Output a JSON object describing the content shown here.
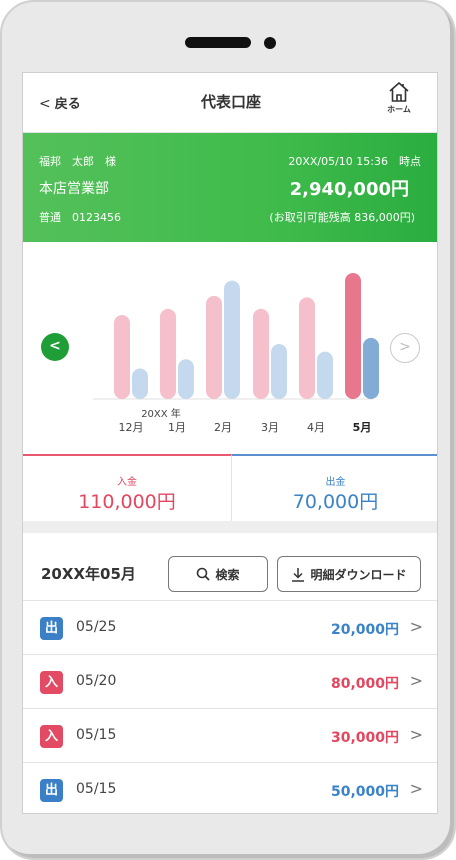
{
  "header": {
    "back_label": "戻る",
    "back_chevron": "<",
    "title": "代表口座",
    "home_label": "ホーム",
    "home_icon": "home-icon"
  },
  "account": {
    "owner": "福邦　太郎　様",
    "timestamp": "20XX/05/10 15:36　時点",
    "branch": "本店営業部",
    "balance": "2,940,000円",
    "account_type_number": "普通　0123456",
    "available": "(お取引可能残高 836,000円)"
  },
  "chart_data": {
    "type": "bar",
    "year_label": "20XX 年",
    "categories": [
      "12月",
      "1月",
      "2月",
      "3月",
      "4月",
      "5月"
    ],
    "selected_index": 5,
    "series": [
      {
        "name": "入金",
        "values": [
          110,
          118,
          135,
          118,
          133,
          165
        ],
        "color": "#f5c0cc",
        "selected_color": "#e8768c"
      },
      {
        "name": "出金",
        "values": [
          40,
          52,
          155,
          72,
          62,
          80
        ],
        "color": "#c5d9ee",
        "selected_color": "#82acd6"
      }
    ],
    "colors": {
      "deposit": "#f5c0cc",
      "withdrawal": "#c5d9ee"
    }
  },
  "summary": {
    "deposit_label": "入金",
    "deposit_value": "110,000円",
    "withdrawal_label": "出金",
    "withdrawal_value": "70,000円"
  },
  "list_header": {
    "month": "20XX年05月",
    "search_label": "検索",
    "download_label": "明細ダウンロード"
  },
  "transactions": [
    {
      "type": "出",
      "kind": "out",
      "date": "05/25",
      "amount": "20,000円"
    },
    {
      "type": "入",
      "kind": "in",
      "date": "05/20",
      "amount": "80,000円"
    },
    {
      "type": "入",
      "kind": "in",
      "date": "05/15",
      "amount": "30,000円"
    },
    {
      "type": "出",
      "kind": "out",
      "date": "05/15",
      "amount": "50,000円"
    }
  ],
  "colors": {
    "brand_green": "#3fbb4b",
    "deposit_red": "#e3475f",
    "withdrawal_blue": "#3a82c9"
  }
}
